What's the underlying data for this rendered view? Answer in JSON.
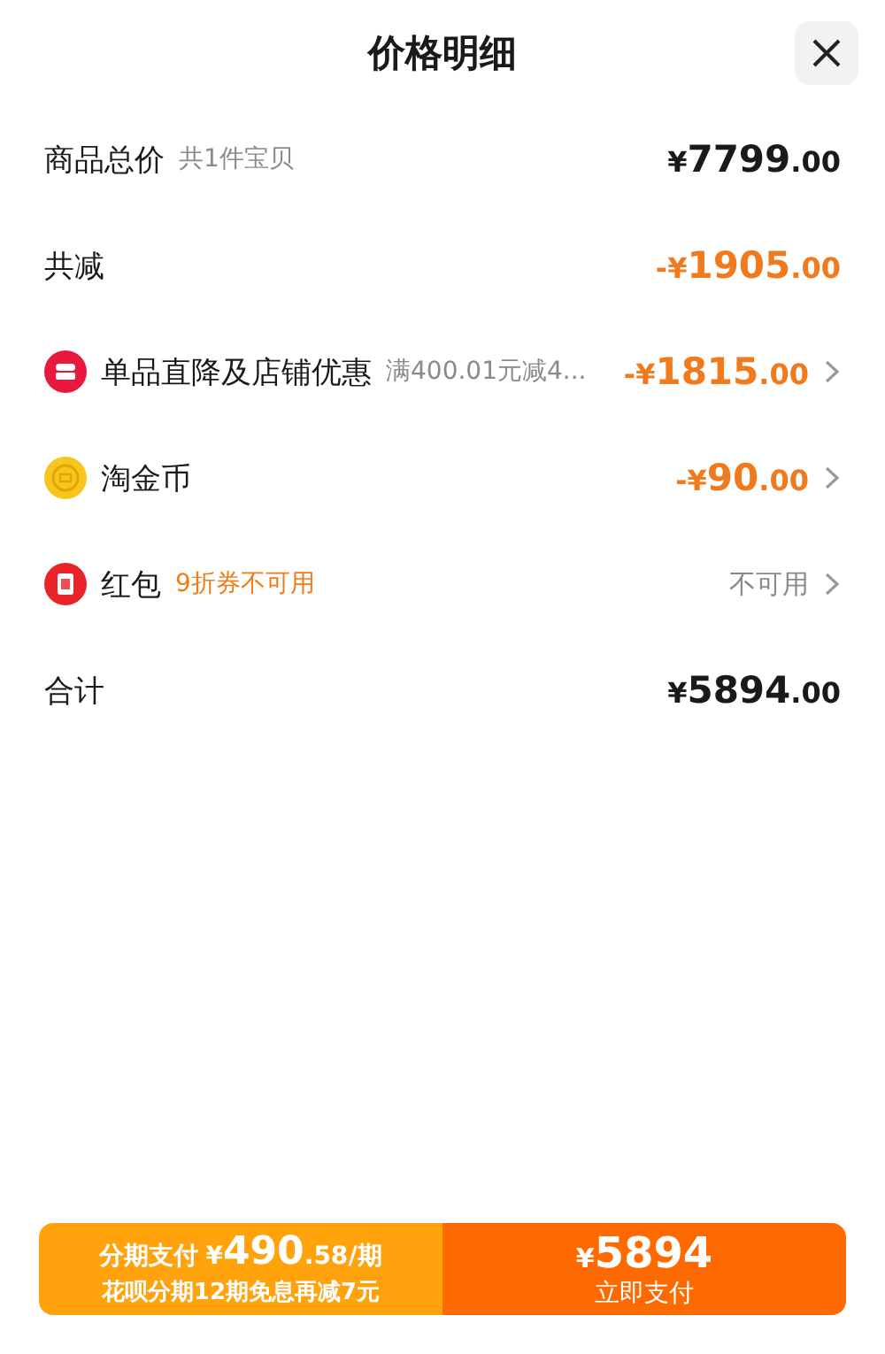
{
  "header": {
    "title": "价格明细"
  },
  "rows": [
    {
      "kind": "subtotal",
      "label": "商品总价",
      "note": "共1件宝贝",
      "amount": {
        "sign": "¥",
        "integer": "7799",
        "decimals": ".00"
      },
      "chevron": false
    },
    {
      "kind": "reduction",
      "label": "共减",
      "amount": {
        "sign": "-¥",
        "integer": "1905",
        "decimals": ".00"
      },
      "chevron": false
    },
    {
      "kind": "shop-discount",
      "label": "单品直降及店铺优惠",
      "note": "满400.01元减4...",
      "amount": {
        "sign": "-¥",
        "integer": "1815",
        "decimals": ".00"
      },
      "chevron": true
    },
    {
      "kind": "coin",
      "label": "淘金币",
      "amount": {
        "sign": "-¥",
        "integer": "90",
        "decimals": ".00"
      },
      "chevron": true
    },
    {
      "kind": "red-envelope",
      "label": "红包",
      "note": "9折券不可用",
      "status": "不可用",
      "chevron": true
    },
    {
      "kind": "total",
      "label": "合计",
      "amount": {
        "sign": "¥",
        "integer": "5894",
        "decimals": ".00"
      },
      "chevron": false
    }
  ],
  "footer": {
    "installment": {
      "label": "分期支付",
      "sign": "¥",
      "integer": "490",
      "decimals": ".58",
      "unit": "/期",
      "subtitle": "花呗分期12期免息再减7元"
    },
    "pay": {
      "sign": "¥",
      "integer": "5894",
      "label": "立即支付"
    }
  }
}
